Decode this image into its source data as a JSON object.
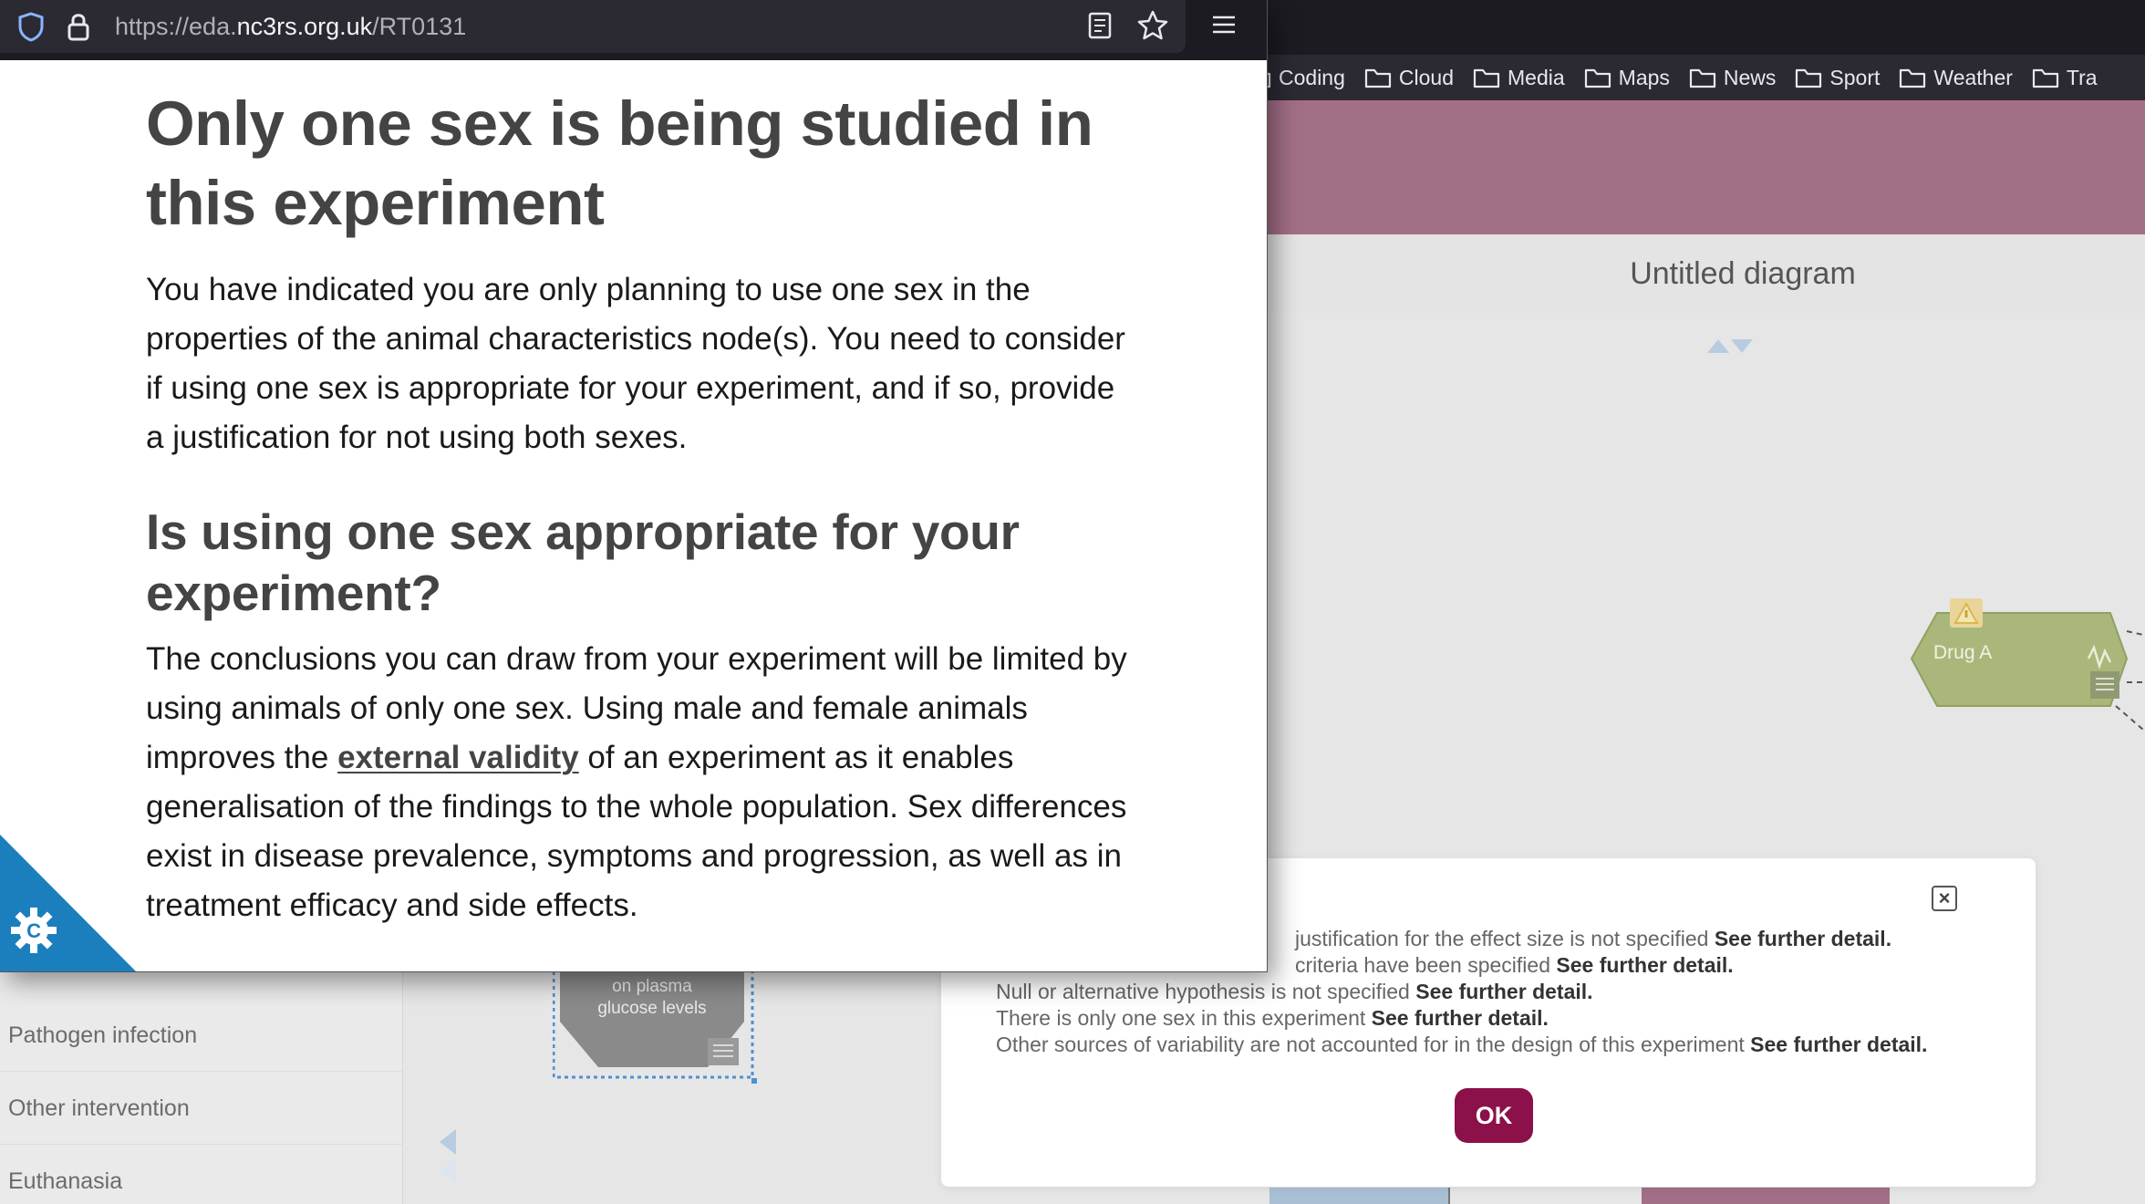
{
  "bookmarks": [
    {
      "label": "Coding"
    },
    {
      "label": "Cloud"
    },
    {
      "label": "Media"
    },
    {
      "label": "Maps"
    },
    {
      "label": "News"
    },
    {
      "label": "Sport"
    },
    {
      "label": "Weather"
    },
    {
      "label": "Tra"
    }
  ],
  "diagram": {
    "title": "Untitled diagram",
    "drug_node_label": "Drug A",
    "plasma_node_label_line1": "on plasma",
    "plasma_node_label_line2": "glucose levels"
  },
  "sidebar": {
    "items": [
      {
        "label": "Pathogen infection"
      },
      {
        "label": "Other intervention"
      },
      {
        "label": "Euthanasia"
      }
    ]
  },
  "dialog": {
    "link_text": "See further detail.",
    "issues": [
      {
        "text": "justification for the effect size is not specified"
      },
      {
        "text": "criteria have been specified"
      },
      {
        "text": "Null or alternative hypothesis is not specified"
      },
      {
        "text": "There is only one sex in this experiment"
      },
      {
        "text": "Other sources of variability are not accounted for in the design of this experiment"
      }
    ],
    "close_label": "×",
    "ok_label": "OK",
    "ok_color": "#8c1049"
  },
  "popup": {
    "url_prefix": "https://eda.",
    "url_domain": "nc3rs.org.uk",
    "url_path": "/RT0131",
    "heading": "Only one sex is being studied in this experiment",
    "intro": "You have indicated you are only planning to use one sex in the properties of the animal characteristics node(s). You need to consider if using one sex is appropriate for your experiment, and if so, provide a justification for not using both sexes.",
    "subheading": "Is using one sex appropriate for your experiment?",
    "body_before": "The conclusions you can draw from your experiment will be limited by using animals of only one sex. Using male and female animals improves the ",
    "body_link": "external validity",
    "body_after": " of an experiment as it enables generalisation of the findings to the whole population. Sex differences exist in disease prevalence, symptoms and progression, as well as in treatment efficacy and side effects."
  },
  "colors": {
    "header_band": "#a36f87",
    "drug_node": "#a9b87a",
    "cookie_tab": "#1b7fbd"
  }
}
